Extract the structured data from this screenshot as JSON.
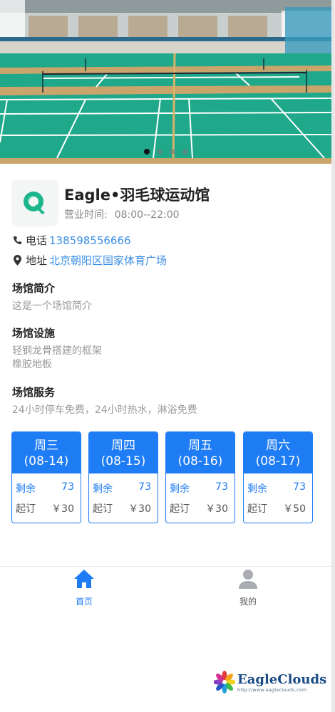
{
  "venue": {
    "name": "Eagle•羽毛球运动馆",
    "hours_label": "营业时间:",
    "hours_value": "08:00--22:00",
    "phone_label": "电话",
    "phone": "138598556666",
    "address_label": "地址",
    "address": "北京朝阳区国家体育广场"
  },
  "banner": {
    "dots": 4,
    "active_dot": 1
  },
  "sections": {
    "intro_title": "场馆简介",
    "intro_text": "这是一个场馆简介",
    "facilities_title": "场馆设施",
    "facilities_line1": "轻钢龙骨搭建的框架",
    "facilities_line2": "橡胶地板",
    "services_title": "场馆服务",
    "services_text": "24小时停车免费，24小时热水，淋浴免费"
  },
  "days": [
    {
      "weekday": "周三",
      "date": "(08-14)",
      "remain_label": "剩余",
      "remain": "73",
      "price_label": "起订",
      "price": "￥30"
    },
    {
      "weekday": "周四",
      "date": "(08-15)",
      "remain_label": "剩余",
      "remain": "73",
      "price_label": "起订",
      "price": "￥30"
    },
    {
      "weekday": "周五",
      "date": "(08-16)",
      "remain_label": "剩余",
      "remain": "73",
      "price_label": "起订",
      "price": "￥30"
    },
    {
      "weekday": "周六",
      "date": "(08-17)",
      "remain_label": "剩余",
      "remain": "73",
      "price_label": "起订",
      "price": "￥50"
    }
  ],
  "tabbar": {
    "home_label": "首页",
    "home_icon": "home-icon",
    "mine_label": "我的",
    "mine_icon": "user-icon"
  },
  "watermark": {
    "brand": "EagleClouds",
    "url": "http://www.eagleclouds.com"
  },
  "colors": {
    "accent": "#1e7cf5",
    "court_green": "#1fa88a",
    "link": "#3a8ee6"
  }
}
